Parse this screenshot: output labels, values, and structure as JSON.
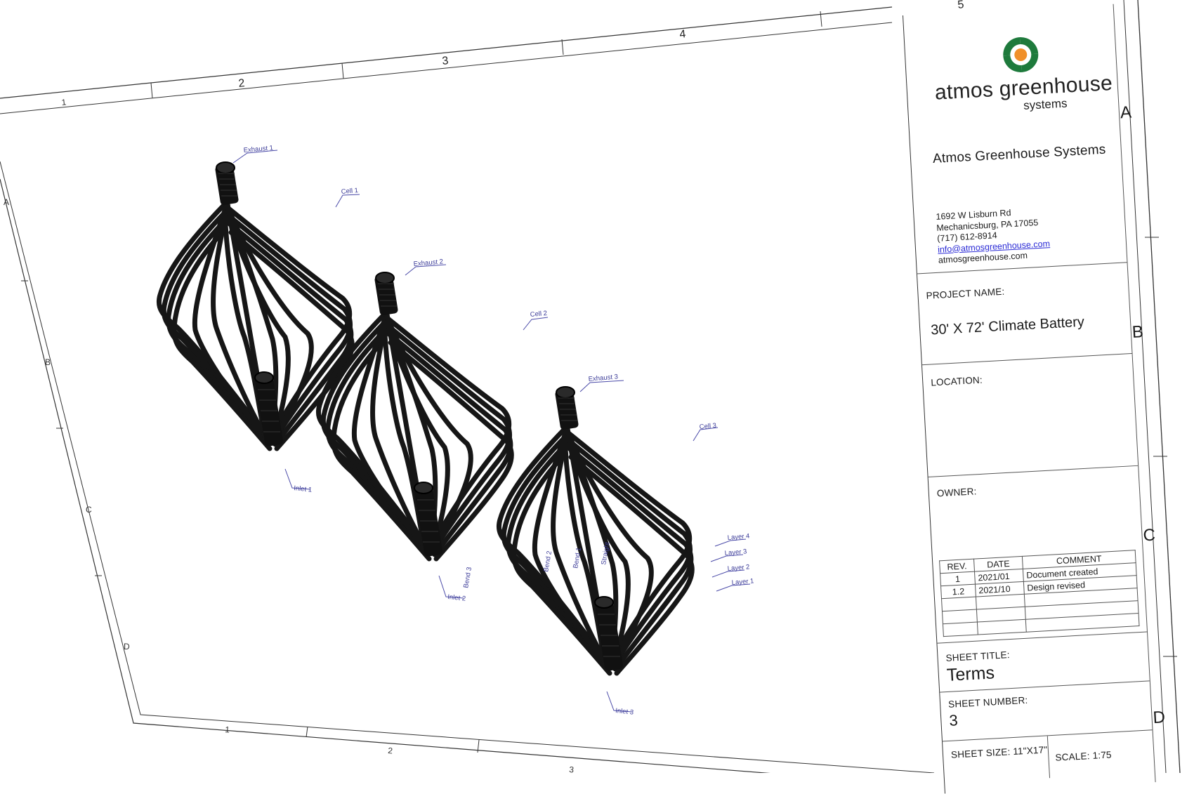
{
  "drawing": {
    "labels": {
      "exhaust": [
        "Exhaust 1",
        "Exhaust 2",
        "Exhaust 3"
      ],
      "cell": [
        "Cell 1",
        "Cell 2",
        "Cell 3"
      ],
      "inlet": [
        "Inlet 1",
        "Inlet 2",
        "Inlet 3"
      ],
      "layers": [
        "Layer 4",
        "Layer 3",
        "Layer 2",
        "Layer 1"
      ],
      "bends": [
        "Bend 3",
        "Bend 2",
        "Bend 1",
        "Straight"
      ]
    },
    "border": {
      "top_numbers": [
        "1",
        "2",
        "3",
        "4",
        "5"
      ],
      "bottom_numbers": [
        "1",
        "2",
        "3"
      ],
      "left_letters": [
        "A",
        "B",
        "C",
        "D"
      ]
    }
  },
  "title_block": {
    "logo": {
      "word1": "atmos greenhouse",
      "word2": "systems",
      "colors": [
        "#1e7a3c",
        "#f0902a"
      ]
    },
    "company": "Atmos Greenhouse Systems",
    "address": {
      "street": "1692 W Lisburn Rd",
      "city": "Mechanicsburg, PA 17055",
      "phone": "(717) 612-8914",
      "email": "info@atmosgreenhouse.com",
      "web": "atmosgreenhouse.com"
    },
    "project_label": "PROJECT NAME:",
    "project_name": "30' X 72' Climate Battery",
    "location_label": "LOCATION:",
    "owner_label": "OWNER:",
    "revisions": {
      "headers": [
        "REV.",
        "DATE",
        "COMMENT"
      ],
      "rows": [
        {
          "rev": "1",
          "date": "2021/01",
          "comment": "Document created"
        },
        {
          "rev": "1.2",
          "date": "2021/10",
          "comment": "Design revised"
        }
      ]
    },
    "sheet_title_label": "SHEET TITLE:",
    "sheet_title": "Terms",
    "sheet_number_label": "SHEET NUMBER:",
    "sheet_number": "3",
    "sheet_size": "SHEET SIZE: 11\"X17\"",
    "scale": "SCALE: 1:75",
    "zone_letters": [
      "A",
      "B",
      "C",
      "D"
    ]
  }
}
